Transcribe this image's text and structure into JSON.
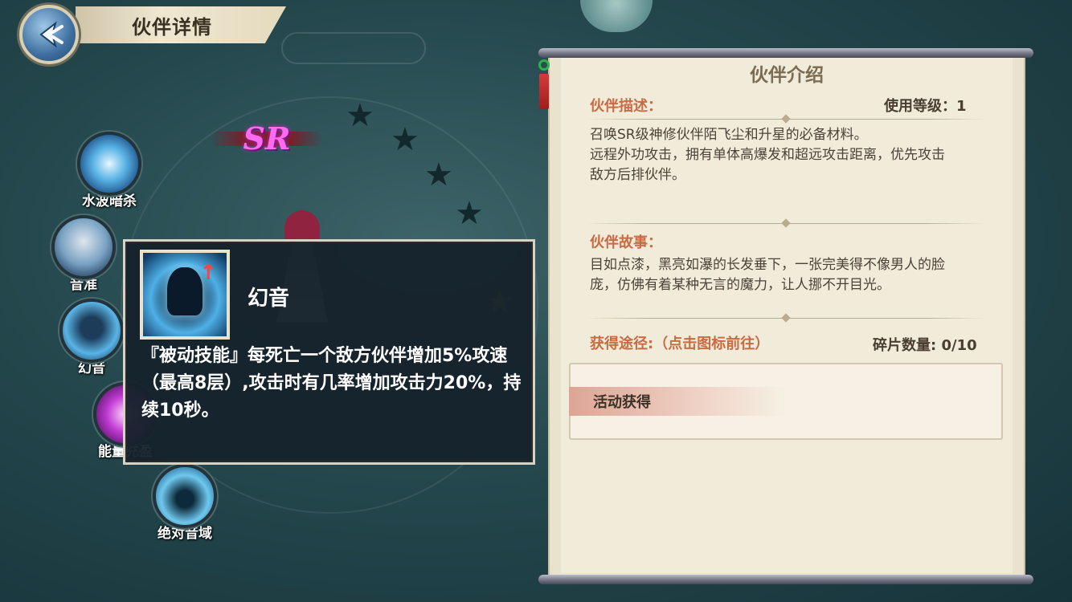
{
  "header": {
    "title": "伙伴详情",
    "back_icon": "back-arrow-icon"
  },
  "partner": {
    "rarity": "SR",
    "stars_total": 5,
    "stars_filled": 1
  },
  "skills": [
    {
      "name": "水波暗杀",
      "icon": "water-wave-icon"
    },
    {
      "name": "音准",
      "icon": "blade-icon"
    },
    {
      "name": "幻音",
      "icon": "phantom-icon"
    },
    {
      "name": "能量充盈",
      "icon": "energy-icon"
    },
    {
      "name": "绝对音域",
      "icon": "sound-field-icon"
    }
  ],
  "tooltip": {
    "skill_name": "幻音",
    "description": "『被动技能』每死亡一个敌方伙伴增加5%攻速（最高8层）,攻击时有几率增加攻击力20%，持续10秒。"
  },
  "panel": {
    "title": "伙伴介绍",
    "description": {
      "label": "伙伴描述：",
      "level_text": "使用等级：1",
      "lines": [
        "召唤SR级神修伙伴陌飞尘和升星的必备材料。",
        "远程外功攻击，拥有单体高爆发和超远攻击距离，优先攻击",
        "敌方后排伙伴。"
      ]
    },
    "story": {
      "label": "伙伴故事：",
      "lines": [
        "目如点漆，黑亮如瀑的长发垂下，一张完美得不像男人的脸",
        "庞，仿佛有着某种无言的魔力，让人挪不开目光。"
      ]
    },
    "source": {
      "label": "获得途径:（点击图标前往）",
      "fragments_text": "碎片数量: 0/10",
      "items": [
        "活动获得"
      ]
    }
  },
  "colors": {
    "accent": "#c96b43",
    "tooltip_bg": "#16222c",
    "panel_bg": "#e9e2cf",
    "rarity": "#ff6bf0"
  }
}
